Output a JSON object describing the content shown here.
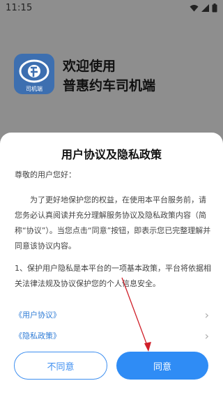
{
  "status_bar": {
    "time": "11:15"
  },
  "splash": {
    "logo_label": "司机端",
    "welcome": "欢迎使用",
    "app_name": "普惠约车司机端"
  },
  "dialog": {
    "title": "用户协议及隐私政策",
    "greeting": "尊敬的用户您好：",
    "paragraph1": "为了更好地保护您的权益，在使用本平台服务前，请您务必认真阅读并充分理解服务协议及隐私政策内容（简称“协议”）。当您点击“同意”按钮，即表示您已完整理解并同意该协议内容。",
    "paragraph2": "1、保护用户隐私是本平台的一项基本政策，平台将依据相关法律法规及协议保护您的个人信息安全。",
    "links": [
      {
        "label": "《用户协议》"
      },
      {
        "label": "《隐私政策》"
      }
    ],
    "disagree_label": "不同意",
    "agree_label": "同意"
  },
  "colors": {
    "accent": "#2f8cf5",
    "link": "#2f7cd6",
    "annotation_arrow": "#d0202a"
  }
}
